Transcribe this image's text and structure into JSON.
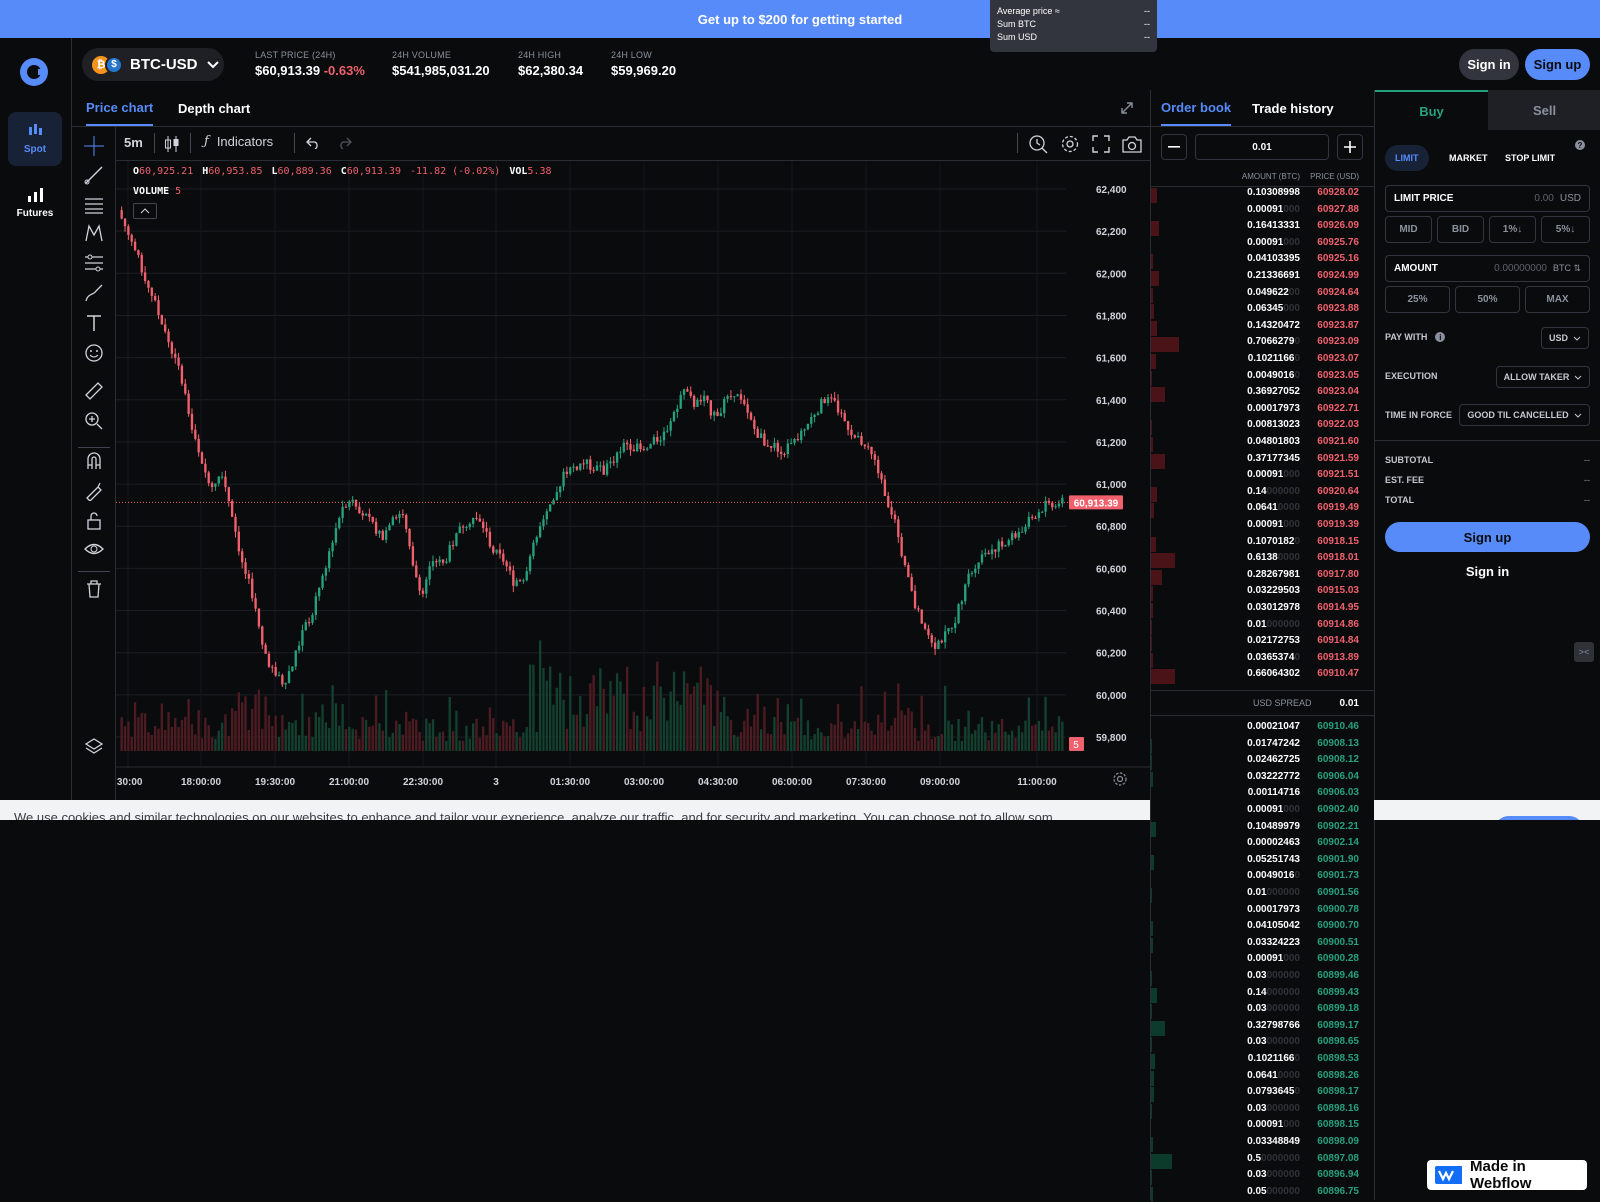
{
  "banner": {
    "text": "Get up to $200 for getting started"
  },
  "avg_box": {
    "rows": [
      {
        "label": "Average price ≈",
        "value": "--"
      },
      {
        "label": "Sum BTC",
        "value": "--"
      },
      {
        "label": "Sum USD",
        "value": "--"
      }
    ]
  },
  "nav": {
    "spot": "Spot",
    "futures": "Futures"
  },
  "header": {
    "pair": "BTC-USD",
    "stats": [
      {
        "label": "LAST PRICE (24H)",
        "value": "$60,913.39",
        "change": "-0.63%"
      },
      {
        "label": "24H VOLUME",
        "value": "$541,985,031.20"
      },
      {
        "label": "24H HIGH",
        "value": "$62,380.34"
      },
      {
        "label": "24H LOW",
        "value": "$59,969.20"
      }
    ],
    "signin": "Sign in",
    "signup": "Sign up"
  },
  "tabs": {
    "price_chart": "Price chart",
    "depth_chart": "Depth chart"
  },
  "toolbar": {
    "interval": "5m",
    "indicators": "Indicators"
  },
  "colors": {
    "up": "#26a17b",
    "down": "#f0616d",
    "accent": "#578bfa",
    "bg": "#0a0b0d"
  },
  "chart_data": {
    "type": "candlestick",
    "ohlc_legend": {
      "o_label": "O",
      "o": "60,925.21",
      "h_label": "H",
      "h": "60,953.85",
      "l_label": "L",
      "l": "60,889.36",
      "c_label": "C",
      "c": "60,913.39",
      "chg": "-11.82 (-0.02%)",
      "vol_label": "VOL",
      "vol": "5.38"
    },
    "volume_legend": {
      "label": "VOLUME",
      "value": "5"
    },
    "y_ticks": [
      "62,400",
      "62,200",
      "62,000",
      "61,800",
      "61,600",
      "61,400",
      "61,200",
      "61,000",
      "60,800",
      "60,600",
      "60,400",
      "60,200",
      "60,000",
      "59,800"
    ],
    "y_range": [
      59800,
      62400
    ],
    "x_ticks": [
      ":30:00",
      "18:00:00",
      "19:30:00",
      "21:00:00",
      "22:30:00",
      "3",
      "01:30:00",
      "03:00:00",
      "04:30:00",
      "06:00:00",
      "07:30:00",
      "09:00:00",
      "11:00:00"
    ],
    "last_price_label": "60,913.39",
    "last_price": 60913.39,
    "volume_label": "5",
    "close_path": [
      62260,
      62150,
      62020,
      61900,
      61760,
      61630,
      61500,
      61260,
      61080,
      61000,
      61060,
      60860,
      60620,
      60480,
      60230,
      60120,
      60050,
      60140,
      60300,
      60390,
      60560,
      60740,
      60900,
      60940,
      60860,
      60800,
      60760,
      60860,
      60860,
      60600,
      60480,
      60640,
      60620,
      60720,
      60810,
      60840,
      60800,
      60680,
      60640,
      60540,
      60560,
      60700,
      60840,
      60900,
      61060,
      61080,
      61100,
      61080,
      61060,
      61120,
      61200,
      61180,
      61150,
      61200,
      61240,
      61340,
      61440,
      61380,
      61400,
      61320,
      61380,
      61440,
      61360,
      61260,
      61200,
      61180,
      61160,
      61200,
      61260,
      61340,
      61400,
      61380,
      61300,
      61220,
      61180,
      61100,
      60960,
      60820,
      60600,
      60420,
      60320,
      60240,
      60280,
      60360,
      60520,
      60620,
      60680,
      60700,
      60720,
      60760,
      60800,
      60860,
      60900,
      60913
    ]
  },
  "orderbook": {
    "tab_book": "Order book",
    "tab_trades": "Trade history",
    "increment": "0.01",
    "col_amount": "AMOUNT (BTC)",
    "col_price": "PRICE (USD)",
    "asks": [
      [
        "0.10308998",
        "",
        "60928.",
        "02",
        6
      ],
      [
        "0.00091",
        "000",
        "60927.",
        "88",
        0
      ],
      [
        "0.16413331",
        "",
        "60926.",
        "09",
        8
      ],
      [
        "0.00091",
        "000",
        "60925.",
        "76",
        0
      ],
      [
        "0.04103395",
        "",
        "60925.",
        "16",
        2
      ],
      [
        "0.21336691",
        "",
        "60924.",
        "99",
        8
      ],
      [
        "0.049622",
        "00",
        "60924.",
        "64",
        2
      ],
      [
        "0.06345",
        "000",
        "60923.",
        "88",
        3
      ],
      [
        "0.14320472",
        "",
        "60923.",
        "87",
        6
      ],
      [
        "0.7066279",
        "0",
        "60923.",
        "09",
        28
      ],
      [
        "0.1021166",
        "0",
        "60923.",
        "07",
        5
      ],
      [
        "0.0049016",
        "0",
        "60923.",
        "05",
        1
      ],
      [
        "0.36927052",
        "",
        "60923.",
        "04",
        14
      ],
      [
        "0.00017973",
        "",
        "60922.",
        "71",
        0
      ],
      [
        "0.00813023",
        "",
        "60922.",
        "03",
        1
      ],
      [
        "0.04801803",
        "",
        "60921.",
        "60",
        2
      ],
      [
        "0.37177345",
        "",
        "60921.",
        "59",
        14
      ],
      [
        "0.00091",
        "000",
        "60921.",
        "51",
        0
      ],
      [
        "0.14",
        "000000",
        "60920.",
        "64",
        6
      ],
      [
        "0.0641",
        "0000",
        "60919.",
        "49",
        3
      ],
      [
        "0.00091",
        "000",
        "60919.",
        "39",
        0
      ],
      [
        "0.1070182",
        "0",
        "60918.",
        "15",
        5
      ],
      [
        "0.6138",
        "0000",
        "60918.",
        "01",
        24
      ],
      [
        "0.28267981",
        "",
        "60917.",
        "80",
        11
      ],
      [
        "0.03229503",
        "",
        "60915.",
        "03",
        2
      ],
      [
        "0.03012978",
        "",
        "60914.",
        "95",
        2
      ],
      [
        "0.01",
        "000000",
        "60914.",
        "86",
        1
      ],
      [
        "0.02172753",
        "",
        "60914.",
        "84",
        1
      ],
      [
        "0.0365374",
        "0",
        "60913.",
        "89",
        2
      ],
      [
        "0.66064302",
        "",
        "60910.",
        "47",
        24
      ]
    ],
    "spread_label": "USD SPREAD",
    "spread": "0.01",
    "bids": [
      [
        "0.00021047",
        "",
        "60910.",
        "46",
        0
      ],
      [
        "0.01747242",
        "",
        "60908.",
        "13",
        1
      ],
      [
        "0.02462725",
        "",
        "60908.",
        "12",
        1
      ],
      [
        "0.03222772",
        "",
        "60906.",
        "04",
        2
      ],
      [
        "0.00114716",
        "",
        "60906.",
        "03",
        0
      ],
      [
        "0.00091",
        "000",
        "60902.",
        "40",
        0
      ],
      [
        "0.10489979",
        "",
        "60902.",
        "21",
        5
      ],
      [
        "0.00002463",
        "",
        "60902.",
        "14",
        0
      ],
      [
        "0.05251743",
        "",
        "60901.",
        "90",
        3
      ],
      [
        "0.0049016",
        "0",
        "60901.",
        "73",
        0
      ],
      [
        "0.01",
        "000000",
        "60901.",
        "56",
        1
      ],
      [
        "0.00017973",
        "",
        "60900.",
        "78",
        0
      ],
      [
        "0.04105042",
        "",
        "60900.",
        "70",
        2
      ],
      [
        "0.03324223",
        "",
        "60900.",
        "51",
        2
      ],
      [
        "0.00091",
        "000",
        "60900.",
        "28",
        0
      ],
      [
        "0.03",
        "000000",
        "60899.",
        "46",
        1
      ],
      [
        "0.14",
        "000000",
        "60899.",
        "43",
        6
      ],
      [
        "0.03",
        "000000",
        "60899.",
        "18",
        1
      ],
      [
        "0.32798766",
        "",
        "60899.",
        "17",
        14
      ],
      [
        "0.03",
        "000000",
        "60898.",
        "65",
        1
      ],
      [
        "0.1021166",
        "0",
        "60898.",
        "53",
        4
      ],
      [
        "0.0641",
        "0000",
        "60898.",
        "26",
        3
      ],
      [
        "0.0793645",
        "0",
        "60898.",
        "17",
        3
      ],
      [
        "0.03",
        "000000",
        "60898.",
        "16",
        1
      ],
      [
        "0.00091",
        "000",
        "60898.",
        "15",
        0
      ],
      [
        "0.03348849",
        "",
        "60898.",
        "09",
        2
      ],
      [
        "0.5",
        "0000000",
        "60897.",
        "08",
        21
      ],
      [
        "0.03",
        "000000",
        "60896.",
        "94",
        1
      ],
      [
        "0.05",
        "000000",
        "60896.",
        "75",
        2
      ]
    ]
  },
  "trade": {
    "buy": "Buy",
    "sell": "Sell",
    "order_types": [
      "LIMIT",
      "MARKET",
      "STOP LIMIT"
    ],
    "limit_price_label": "LIMIT PRICE",
    "limit_price_value": "0.00",
    "limit_price_unit": "USD",
    "price_presets": [
      "MID",
      "BID",
      "1%↓",
      "5%↓"
    ],
    "amount_label": "AMOUNT",
    "amount_value": "0.00000000",
    "amount_unit": "BTC ⇅",
    "amount_presets": [
      "25%",
      "50%",
      "MAX"
    ],
    "pay_with_label": "PAY WITH",
    "pay_with_value": "USD",
    "execution_label": "EXECUTION",
    "execution_value": "ALLOW TAKER",
    "tif_label": "TIME IN FORCE",
    "tif_value": "GOOD TIL CANCELLED",
    "subtotal_label": "SUBTOTAL",
    "subtotal": "--",
    "fee_label": "EST. FEE",
    "fee": "--",
    "total_label": "TOTAL",
    "total": "--",
    "signup": "Sign up",
    "signin": "Sign in"
  },
  "cookie": {
    "text": "We use cookies and similar technologies on our websites to enhance and tailor your experience, analyze our traffic, and for security and marketing. You can choose not to allow som"
  },
  "webflow": {
    "text": "Made in Webflow"
  }
}
